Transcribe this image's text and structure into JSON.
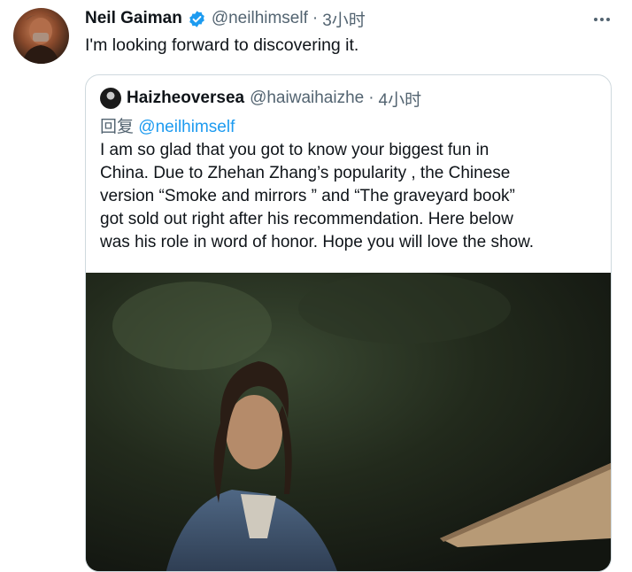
{
  "tweet": {
    "author_name": "Neil Gaiman",
    "handle": "@neilhimself",
    "separator": "·",
    "time": "3小时",
    "text": "I'm looking forward to discovering it.",
    "more_icon": "ellipsis-icon"
  },
  "quoted_tweet": {
    "author_name": "Haizheoversea",
    "handle": "@haiwaihaizhe",
    "separator": "·",
    "time": "4小时",
    "reply_prefix": "回复",
    "reply_to": "@neilhimself",
    "text_lines": [
      "I am so glad that you got to know your biggest fun in",
      "China. Due to Zhehan Zhang’s popularity , the Chinese",
      "version  “Smoke and mirrors ” and “The graveyard book”",
      "got sold out right after his recommendation. Here below",
      "was his role in word of honor.  Hope you will love the show."
    ]
  },
  "colors": {
    "secondary_text": "#536471",
    "link": "#1d9bf0",
    "verified_badge": "#1d9bf0",
    "border": "#cfd9de"
  }
}
